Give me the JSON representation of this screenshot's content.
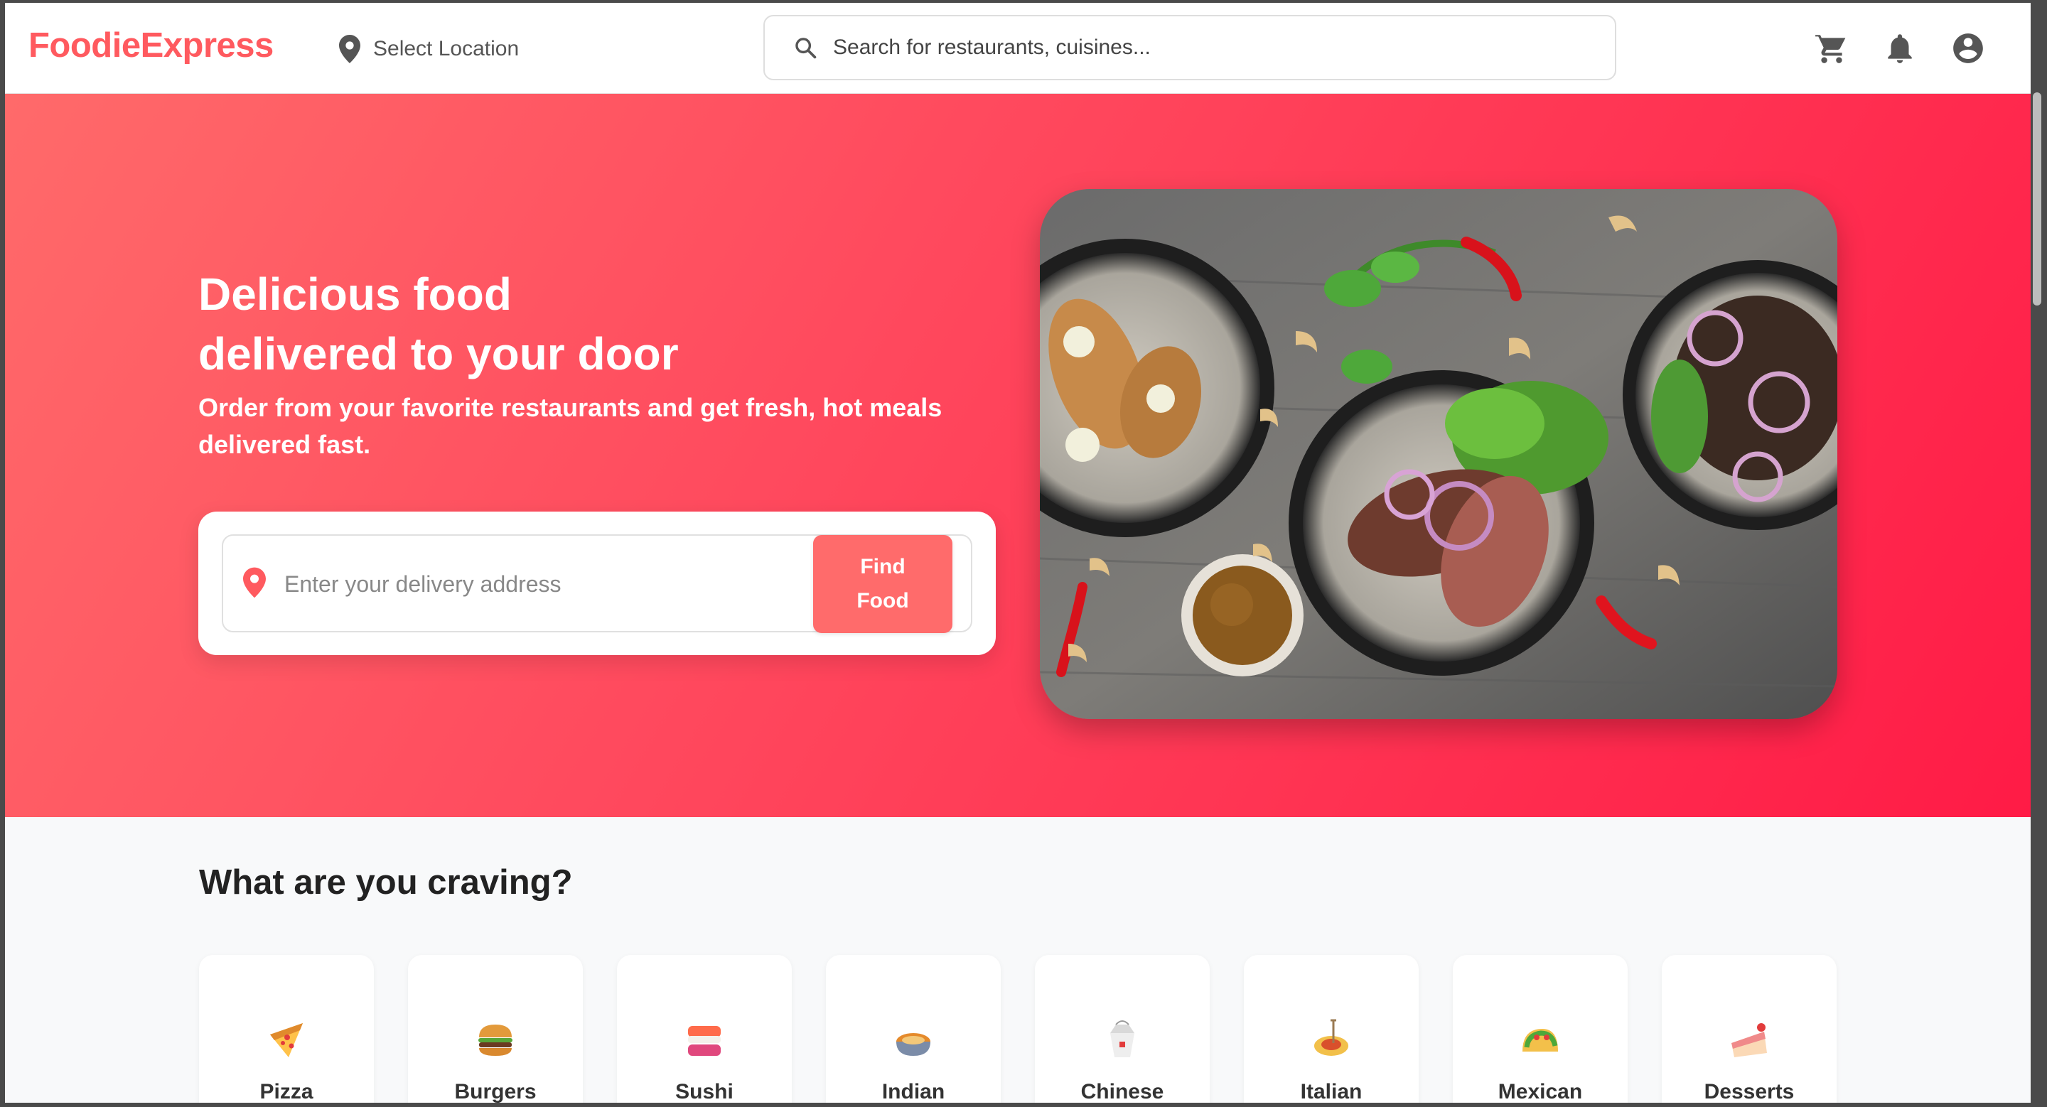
{
  "header": {
    "logo": "FoodieExpress",
    "location_label": "Select Location",
    "search_placeholder": "Search for restaurants, cuisines..."
  },
  "hero": {
    "title_line1": "Delicious food",
    "title_line2": "delivered to your door",
    "subtitle_line1": "Order from your favorite restaurants and get fresh, hot meals",
    "subtitle_line2": "delivered fast.",
    "address_placeholder": "Enter your delivery address",
    "find_line1": "Find",
    "find_line2": "Food"
  },
  "categories": {
    "title": "What are you craving?",
    "items": [
      {
        "label": "Pizza",
        "icon": "pizza-icon"
      },
      {
        "label": "Burgers",
        "icon": "burger-icon"
      },
      {
        "label": "Sushi",
        "icon": "sushi-icon"
      },
      {
        "label": "Indian",
        "icon": "curry-icon"
      },
      {
        "label": "Chinese",
        "icon": "takeout-box-icon"
      },
      {
        "label": "Italian",
        "icon": "spaghetti-icon"
      },
      {
        "label": "Mexican",
        "icon": "taco-icon"
      },
      {
        "label": "Desserts",
        "icon": "cake-icon"
      }
    ]
  },
  "colors": {
    "brand": "#ff5a5f",
    "hero_start": "#ff6a6a",
    "hero_end": "#ff1b46",
    "button": "#ff6b6b"
  }
}
